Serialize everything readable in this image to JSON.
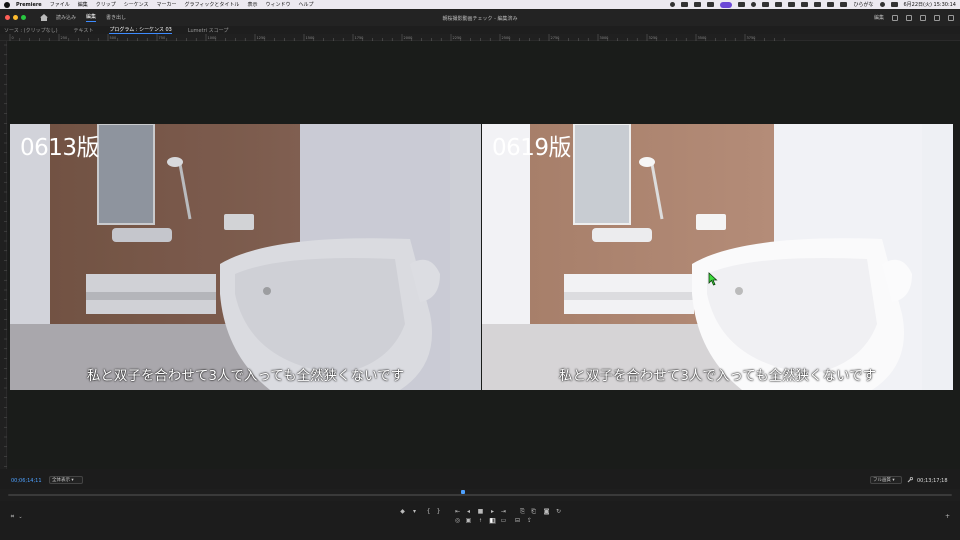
{
  "menubar": {
    "app_name": "Premiere",
    "items": [
      "ファイル",
      "編集",
      "クリップ",
      "シーケンス",
      "マーカー",
      "グラフィックとタイトル",
      "表示",
      "ウィンドウ",
      "ヘルプ"
    ],
    "user_label": "ひらがな",
    "clock": "6月22日(火) 15:30:14"
  },
  "header": {
    "tabs": [
      "読み込み",
      "編集",
      "書き出し"
    ],
    "active_tab": "編集",
    "doc_title": "朝桜撮影動画チェック - 編集済み",
    "right_label": "編集"
  },
  "panel_tabs": [
    "ソース : (クリップなし)",
    "テキスト",
    "プログラム : シーケンス 03",
    "Lumetri スコープ"
  ],
  "ruler": {
    "ticks": [
      "0",
      "250",
      "500",
      "750",
      "1000",
      "1250",
      "1500",
      "1750",
      "2000",
      "2250",
      "2500",
      "2750",
      "3000",
      "3250",
      "3500",
      "3750"
    ]
  },
  "monitor": {
    "left": {
      "label": "0613版",
      "subtitle": "私と双子を合わせて3人で入っても全然狭くないです"
    },
    "right": {
      "label": "0619版",
      "subtitle": "私と双子を合わせて3人で入っても全然狭くないです"
    }
  },
  "timecode": {
    "current": "00;06;14;11",
    "fit": "全体表示",
    "quality": "フル画質",
    "duration": "00;13;17;18"
  },
  "colors": {
    "accent": "#3d8bff",
    "timecode": "#4ea1ff"
  }
}
